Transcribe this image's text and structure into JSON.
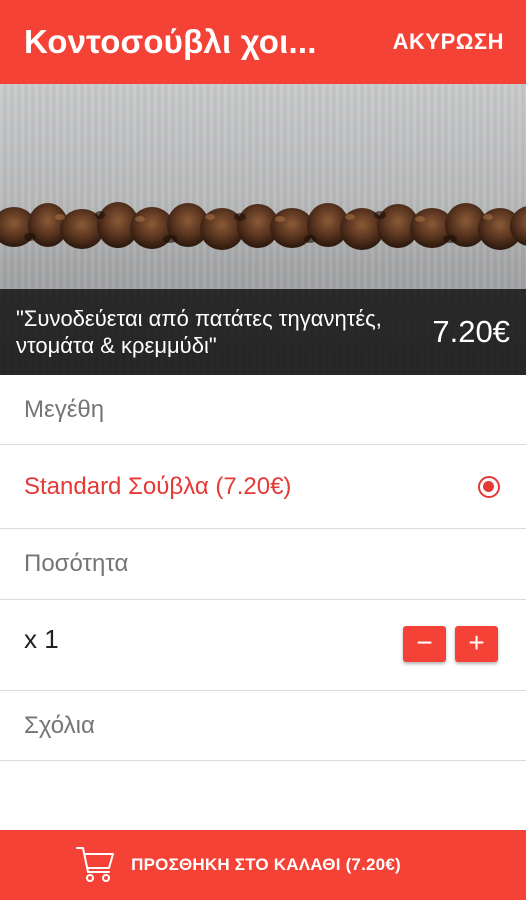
{
  "header": {
    "title": "Κοντοσούβλι χοι...",
    "cancel_label": "ΑΚΥΡΩΣΗ"
  },
  "hero": {
    "description": "\"Συνοδεύεται από πατάτες τηγανητές, ντομάτα & κρεμμύδι\"",
    "price": "7.20€"
  },
  "sizes": {
    "label": "Μεγέθη",
    "options": [
      {
        "label": "Standard Σούβλα (7.20€)",
        "selected": true
      }
    ]
  },
  "quantity": {
    "label": "Ποσότητα",
    "value": "x 1",
    "minus_label": "−",
    "plus_label": "+"
  },
  "notes": {
    "label": "Σχόλια"
  },
  "footer": {
    "add_to_cart_label": "ΠΡΟΣΘΗΚΗ ΣΤΟ ΚΑΛΑΘΙ (7.20€)",
    "cart_icon": "shopping-cart-icon"
  },
  "colors": {
    "accent": "#f44336",
    "selected_text": "#e53935",
    "caption_bg": "#141414"
  }
}
